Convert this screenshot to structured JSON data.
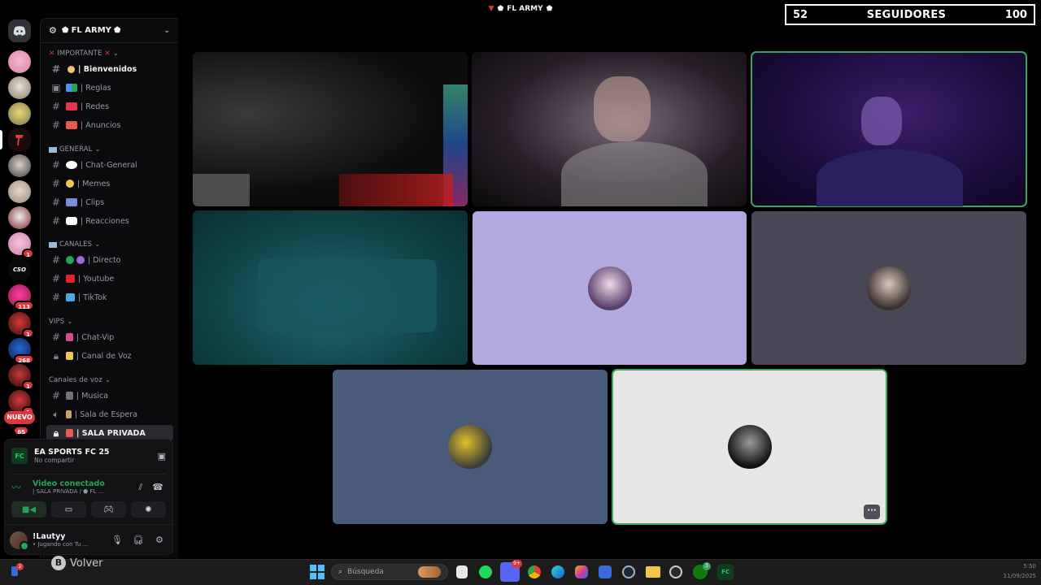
{
  "window": {
    "server_title": "FL ARMY",
    "controls": [
      "?",
      "–",
      "□",
      "✕"
    ]
  },
  "followers_widget": {
    "current": "52",
    "label": "SEGUIDORES",
    "goal": "100"
  },
  "rail": {
    "badges": [
      "1",
      "113",
      "1",
      "268",
      "1",
      "1",
      "65"
    ],
    "nuevo_label": "NUEVO"
  },
  "sidebar": {
    "server_name": "FL ARMY",
    "categories": [
      {
        "label": "IMPORTANTE",
        "channels": [
          {
            "label": "Bienvenidos"
          },
          {
            "label": "Reglas"
          },
          {
            "label": "Redes"
          },
          {
            "label": "Anuncios"
          }
        ]
      },
      {
        "label": "GENERAL",
        "channels": [
          {
            "label": "Chat-General"
          },
          {
            "label": "Memes"
          },
          {
            "label": "Clips"
          },
          {
            "label": "Reacciones"
          }
        ]
      },
      {
        "label": "CANALES",
        "channels": [
          {
            "label": "Directo"
          },
          {
            "label": "Youtube"
          },
          {
            "label": "TikTok"
          }
        ]
      },
      {
        "label": "VIPS",
        "channels": [
          {
            "label": "Chat-Vip"
          },
          {
            "label": "Canal de Voz"
          }
        ]
      },
      {
        "label": "Canales de voz",
        "channels": [
          {
            "label": "Musica"
          },
          {
            "label": "Sala de Espera"
          },
          {
            "label": "SALA PRIVADA"
          }
        ]
      }
    ]
  },
  "voice_panel": {
    "game_title": "EA SPORTS FC 25",
    "game_sub": "No compartir",
    "video_status": "Video conectado",
    "video_sub": "| SALA PRIVADA / ⬟ FL ...",
    "user_name": "!Lautyy",
    "user_status": "• Jugando con Tu ..."
  },
  "taskbar": {
    "volver_key": "B",
    "volver_label": "Volver",
    "search_placeholder": "Búsqueda",
    "notif_badge": "2",
    "discord_badge": "9+",
    "xbox_badge": "3",
    "time": "5:50",
    "date": "11/09/2025"
  },
  "colors": {
    "speaking": "#3ba55d",
    "accent_red": "#da373c",
    "green": "#23a55a"
  }
}
